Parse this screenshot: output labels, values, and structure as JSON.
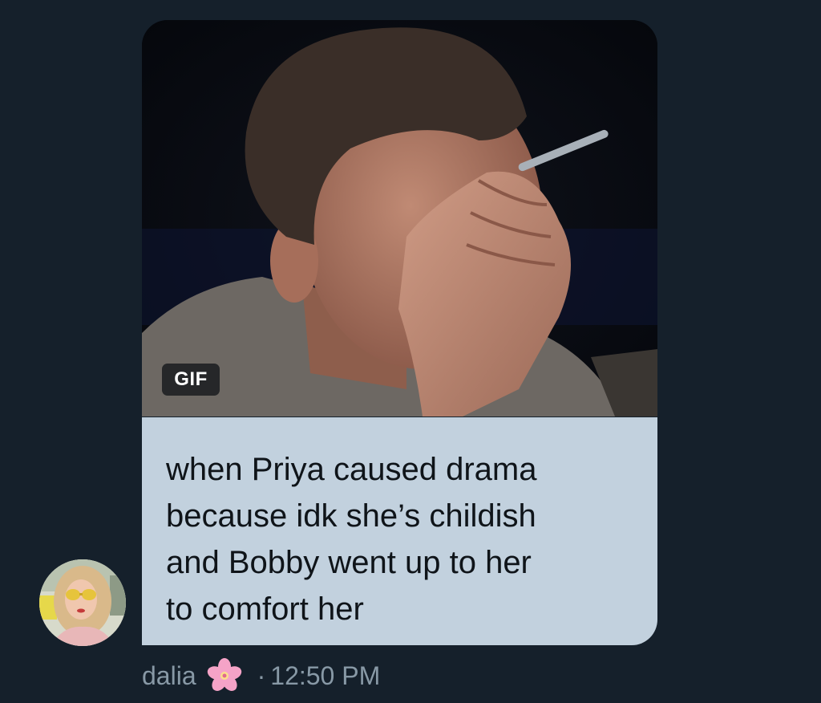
{
  "message": {
    "gif_badge": "GIF",
    "text": "when Priya caused drama\nbecause idk she’s childish\nand Bobby went up to her\nto comfort her"
  },
  "sender": {
    "name": "dalia",
    "emoji_icon": "cherry-blossom-icon",
    "separator": "·",
    "time": "12:50 PM"
  },
  "colors": {
    "background": "#15202b",
    "bubble": "#c2d1de",
    "bubble_text": "#0f1419",
    "meta_text": "#8899a6"
  }
}
